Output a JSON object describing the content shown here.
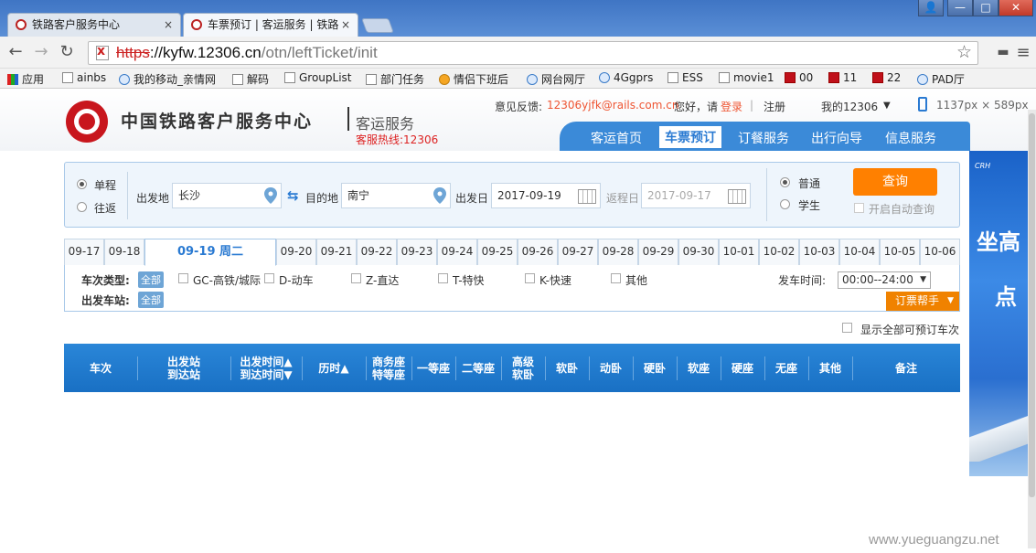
{
  "browser": {
    "tabs": [
      {
        "title": "铁路客户服务中心",
        "close": "×"
      },
      {
        "title": "车票预订 | 客运服务 | 铁路",
        "close": "×"
      }
    ],
    "window_buttons": [
      "👤",
      "—",
      "□",
      "✕"
    ],
    "url": {
      "scheme": "https",
      "host": "://kyfw.12306.cn",
      "path": "/otn/leftTicket/init"
    },
    "bookmarks": [
      "应用",
      "ainbs",
      "我的移动_亲情网",
      "解码",
      "GroupList",
      "部门任务",
      "情侣下班后",
      "网台网厅",
      "4Ggprs",
      "ESS",
      "movie1",
      "00",
      "11",
      "22",
      "PAD厅"
    ]
  },
  "header": {
    "site_name": "中国铁路客户服务中心",
    "service": "客运服务",
    "hotline": "客服热线:12306",
    "feedback_label": "意见反馈:",
    "feedback_email": "12306yjfk@rails.com.cn",
    "greeting": "您好，请",
    "login": "登录",
    "separator": "|",
    "register": "注册",
    "my12306": "我的12306",
    "resolution": "1137px × 589px",
    "nav": [
      "客运首页",
      "车票预订",
      "订餐服务",
      "出行向导",
      "信息服务"
    ]
  },
  "search": {
    "trip_types": [
      "单程",
      "往返"
    ],
    "from_label": "出发地",
    "from_value": "长沙",
    "to_label": "目的地",
    "to_value": "南宁",
    "depart_label": "出发日",
    "depart_value": "2017-09-19",
    "return_label": "返程日",
    "return_value": "2017-09-17",
    "ticket_types": [
      "普通",
      "学生"
    ],
    "query_button": "查询",
    "auto_query": "开启自动查询"
  },
  "dates": [
    "09-17",
    "09-18",
    "09-19 周二",
    "09-20",
    "09-21",
    "09-22",
    "09-23",
    "09-24",
    "09-25",
    "09-26",
    "09-27",
    "09-28",
    "09-29",
    "09-30",
    "10-01",
    "10-02",
    "10-03",
    "10-04",
    "10-05",
    "10-06"
  ],
  "filters": {
    "train_type_label": "车次类型:",
    "all": "全部",
    "train_types": [
      "GC-高铁/城际",
      "D-动车",
      "Z-直达",
      "T-特快",
      "K-快速",
      "其他"
    ],
    "station_label": "出发车站:",
    "time_label": "发车时间:",
    "time_value": "00:00--24:00",
    "help": "订票帮手",
    "show_all": "显示全部可预订车次"
  },
  "table": {
    "columns": [
      "车次",
      "出发站\n到达站",
      "出发时间▲\n到达时间▼",
      "历时▲",
      "商务座\n特等座",
      "一等座",
      "二等座",
      "高级\n软卧",
      "软卧",
      "动卧",
      "硬卧",
      "软座",
      "硬座",
      "无座",
      "其他",
      "备注"
    ]
  },
  "watermark": "www.yueguangzu.net"
}
